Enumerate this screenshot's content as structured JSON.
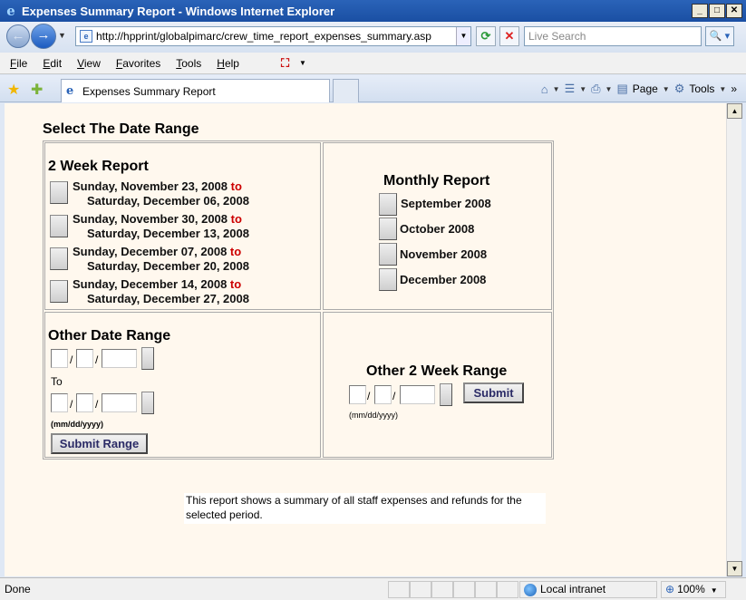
{
  "window": {
    "title": "Expenses Summary Report - Windows Internet Explorer"
  },
  "address": {
    "url": "http://hpprint/globalpimarc/crew_time_report_expenses_summary.asp"
  },
  "search": {
    "placeholder": "Live Search"
  },
  "menu": [
    "File",
    "Edit",
    "View",
    "Favorites",
    "Tools",
    "Help"
  ],
  "tab": {
    "label": "Expenses Summary Report"
  },
  "commandbar": {
    "page": "Page",
    "tools": "Tools"
  },
  "page": {
    "heading": "Select The Date Range",
    "two_week": {
      "title": "2 Week Report",
      "connector": "to",
      "periods": [
        {
          "start": "Sunday, November 23, 2008",
          "end": "Saturday, December 06, 2008"
        },
        {
          "start": "Sunday, November 30, 2008",
          "end": "Saturday, December 13, 2008"
        },
        {
          "start": "Sunday, December 07, 2008",
          "end": "Saturday, December 20, 2008"
        },
        {
          "start": "Sunday, December 14, 2008",
          "end": "Saturday, December 27, 2008"
        }
      ]
    },
    "monthly": {
      "title": "Monthly Report",
      "months": [
        "September  2008",
        "October  2008",
        "November  2008",
        "December  2008"
      ]
    },
    "other_range": {
      "title": "Other Date Range",
      "to_label": "To",
      "format_hint": "(mm/dd/yyyy)",
      "submit_label": "Submit Range"
    },
    "other_two_week": {
      "title": "Other 2 Week Range",
      "format_hint": "(mm/dd/yyyy)",
      "submit_label": "Submit"
    },
    "note": "This report shows a summary of all staff expenses and refunds for the selected period."
  },
  "status": {
    "text": "Done",
    "zone": "Local intranet",
    "zoom": "100%"
  }
}
